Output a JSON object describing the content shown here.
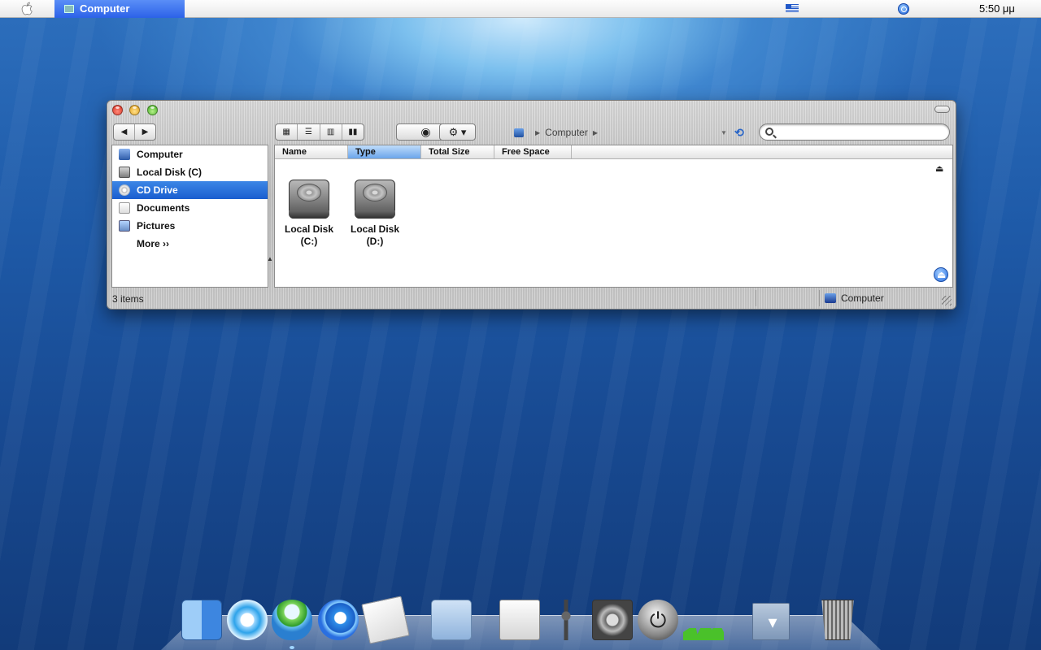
{
  "menubar": {
    "active_app": "Computer",
    "clock": "5:50 μμ",
    "input_language": "greek-flag-icon",
    "spotlight": "spotlight-icon"
  },
  "window": {
    "title": "Computer",
    "path": {
      "items": [
        "Computer"
      ]
    },
    "search": {
      "value": "",
      "placeholder": ""
    },
    "view_buttons": [
      "icon-view",
      "list-view",
      "column-view",
      "coverflow-view"
    ]
  },
  "sidebar": {
    "items": [
      {
        "label": "Computer",
        "icon": "computer-icon"
      },
      {
        "label": "Local Disk (C)",
        "icon": "hard-disk-icon"
      },
      {
        "label": "CD Drive",
        "icon": "cd-icon",
        "selected": true
      },
      {
        "label": "Documents",
        "icon": "documents-icon"
      },
      {
        "label": "Pictures",
        "icon": "pictures-icon"
      }
    ],
    "more": "More"
  },
  "main": {
    "columns": [
      "Name",
      "Type",
      "Total Size",
      "Free Space"
    ],
    "sorted_column": "Type",
    "files": [
      {
        "label_line1": "Local Disk",
        "label_line2": "(C:)"
      },
      {
        "label_line1": "Local Disk",
        "label_line2": "(D:)"
      }
    ]
  },
  "status": {
    "count": "3 items",
    "location": "Computer"
  },
  "dock": [
    "finder",
    "itunes",
    "messenger",
    "internet-explorer",
    "text-editor",
    "documents-folder",
    "snipping-tool",
    "hardware-tool",
    "system-preferences",
    "shutdown",
    "activity-monitor",
    "stack",
    "trash"
  ],
  "colors": {
    "accent": "#1a5ecf",
    "menubar_active": "#2c62e8"
  }
}
